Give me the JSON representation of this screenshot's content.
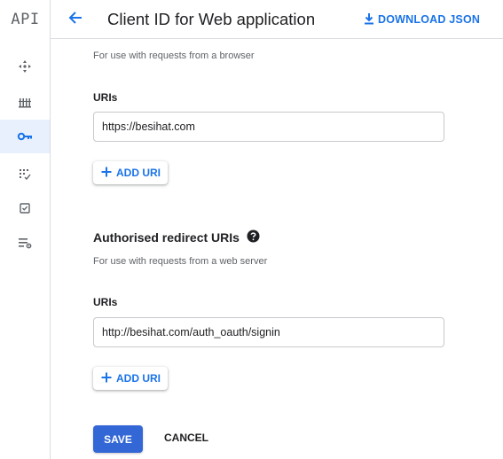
{
  "rail": {
    "logo": "API",
    "items": [
      {
        "icon": "dashboard-icon"
      },
      {
        "icon": "library-icon"
      },
      {
        "icon": "credentials-key-icon",
        "active": true
      },
      {
        "icon": "oauth-consent-icon"
      },
      {
        "icon": "domain-verification-icon"
      },
      {
        "icon": "page-usage-agreements-icon"
      }
    ]
  },
  "header": {
    "title": "Client ID for Web application",
    "download_label": "DOWNLOAD JSON"
  },
  "origins": {
    "hint": "For use with requests from a browser",
    "uris_label": "URIs",
    "uri_value": "https://besihat.com",
    "add_label": "ADD URI"
  },
  "redirects": {
    "title": "Authorised redirect URIs",
    "hint": "For use with requests from a web server",
    "uris_label": "URIs",
    "uri_value": "http://besihat.com/auth_oauth/signin",
    "add_label": "ADD URI"
  },
  "actions": {
    "save_label": "SAVE",
    "cancel_label": "CANCEL"
  },
  "colors": {
    "accent": "#1a73e8",
    "primary_button": "#3367d6",
    "active_rail": "#e8f0fe"
  }
}
